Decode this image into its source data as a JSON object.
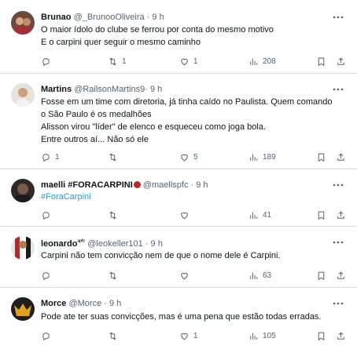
{
  "tweets": [
    {
      "name": "Brunao",
      "handle": "@_BrunooOliveira",
      "sep": "·",
      "time": "9 h",
      "lines": [
        "O maior ídolo do clube se ferrou por conta do mesmo motivo",
        "E o carpini quer seguir o mesmo caminho"
      ],
      "replies": "",
      "retweets": "1",
      "likes": "1",
      "views": "208",
      "avatar_color": "#8a5a44"
    },
    {
      "name": "Martins",
      "handle": "@RailsonMartins9",
      "sep": "·",
      "time": "9 h",
      "lines": [
        "Fosse em um time com diretoria, já tinha caído no Paulista. Quem comando",
        "o São Paulo é os medalhões",
        "Alisson virou \"líder\" de elenco e esqueceu como joga bola.",
        "Entre outros aí... Não só ele"
      ],
      "replies": "1",
      "retweets": "",
      "likes": "5",
      "views": "189",
      "avatar_color": "#c9a07e"
    },
    {
      "name": "maelli #FORACARPINI",
      "handle": "@maellspfc",
      "sep": "·",
      "time": "9 h",
      "hashtag": "#ForaCarpini",
      "replies": "",
      "retweets": "",
      "likes": "",
      "views": "41",
      "avatar_color": "#3a3a3a"
    },
    {
      "name": "leonardo",
      "name_suffix": "ᵃᵖᶠᶜ",
      "handle": "@leokeller101",
      "sep": "·",
      "time": "9 h",
      "lines": [
        "Carpini não tem convicção nem de que o nome dele é Carpini."
      ],
      "replies": "",
      "retweets": "",
      "likes": "",
      "views": "63",
      "avatar_color": "#b22a2a"
    },
    {
      "name": "Morce",
      "handle": "@Morce",
      "sep": "·",
      "time": "9 h",
      "lines": [
        "Pode ate ter suas convicções, mas é uma pena que estão todas erradas."
      ],
      "replies": "",
      "retweets": "",
      "likes": "1",
      "views": "105",
      "avatar_color": "#2b2b2b"
    }
  ],
  "icons": {
    "more": "more-icon",
    "reply": "reply-icon",
    "retweet": "retweet-icon",
    "like": "heart-icon",
    "views": "views-icon",
    "bookmark": "bookmark-icon",
    "share": "share-icon"
  },
  "colors": {
    "text": "#0f1419",
    "secondary": "#536471",
    "hashtag": "#1d9bf0",
    "divider": "#d6dbdf"
  }
}
